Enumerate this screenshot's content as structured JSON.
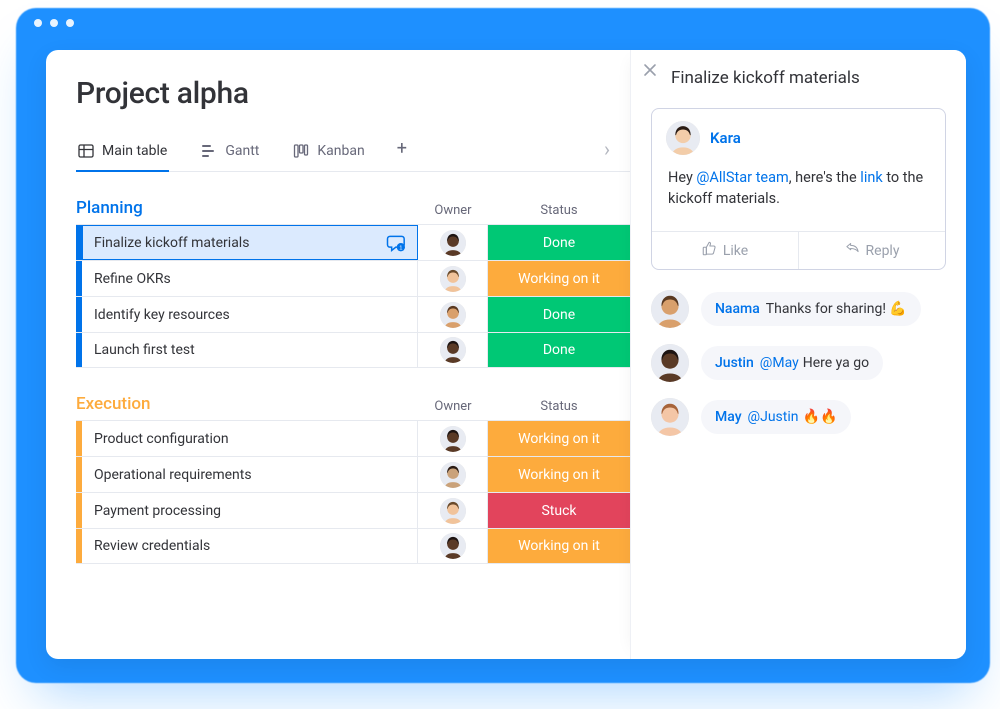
{
  "page": {
    "title": "Project alpha"
  },
  "views": {
    "tabs": [
      {
        "label": "Main table",
        "active": true
      },
      {
        "label": "Gantt",
        "active": false
      },
      {
        "label": "Kanban",
        "active": false
      }
    ]
  },
  "columns": {
    "owner": "Owner",
    "status": "Status"
  },
  "status_labels": {
    "done": "Done",
    "working": "Working on it",
    "stuck": "Stuck"
  },
  "groups": [
    {
      "id": "planning",
      "title": "Planning",
      "color": "#0073ea",
      "rows": [
        {
          "name": "Finalize kickoff materials",
          "status": "done",
          "selected": true,
          "has_chat": true,
          "owner_tone": "dk1"
        },
        {
          "name": "Refine OKRs",
          "status": "working",
          "selected": false,
          "has_chat": false,
          "owner_tone": "lt1"
        },
        {
          "name": "Identify key resources",
          "status": "done",
          "selected": false,
          "has_chat": false,
          "owner_tone": "md1"
        },
        {
          "name": "Launch first test",
          "status": "done",
          "selected": false,
          "has_chat": false,
          "owner_tone": "dk1"
        }
      ]
    },
    {
      "id": "execution",
      "title": "Execution",
      "color": "#fdab3d",
      "rows": [
        {
          "name": "Product configuration",
          "status": "working",
          "selected": false,
          "has_chat": false,
          "owner_tone": "dk1"
        },
        {
          "name": "Operational requirements",
          "status": "working",
          "selected": false,
          "has_chat": false,
          "owner_tone": "md2"
        },
        {
          "name": "Payment processing",
          "status": "stuck",
          "selected": false,
          "has_chat": false,
          "owner_tone": "lt1"
        },
        {
          "name": "Review credentials",
          "status": "working",
          "selected": false,
          "has_chat": false,
          "owner_tone": "dk1"
        }
      ]
    }
  ],
  "side_panel": {
    "title": "Finalize kickoff materials",
    "comment": {
      "author": "Kara",
      "body_pre": "Hey ",
      "mention": "@AllStar team",
      "body_mid": ", here's the ",
      "link_text": "link",
      "body_post": " to the kickoff materials."
    },
    "actions": {
      "like": "Like",
      "reply": "Reply"
    },
    "replies": [
      {
        "who": "Naama",
        "text": "Thanks for sharing! 💪",
        "mention": ""
      },
      {
        "who": "Justin",
        "text": "Here ya go",
        "mention": "@May "
      },
      {
        "who": "May",
        "text": "🔥🔥",
        "mention": "@Justin "
      }
    ]
  },
  "avatar_palettes": {
    "dk1": {
      "skin": "#5a3a26",
      "hair": "#1d1412"
    },
    "md1": {
      "skin": "#d9a06c",
      "hair": "#5a3a22"
    },
    "md2": {
      "skin": "#caa27a",
      "hair": "#2b1c14"
    },
    "lt1": {
      "skin": "#f1c39a",
      "hair": "#6a4a2a"
    },
    "lt2": {
      "skin": "#f3cda9",
      "hair": "#2a1c14"
    },
    "pk1": {
      "skin": "#f4c6a6",
      "hair": "#a7643a"
    }
  }
}
